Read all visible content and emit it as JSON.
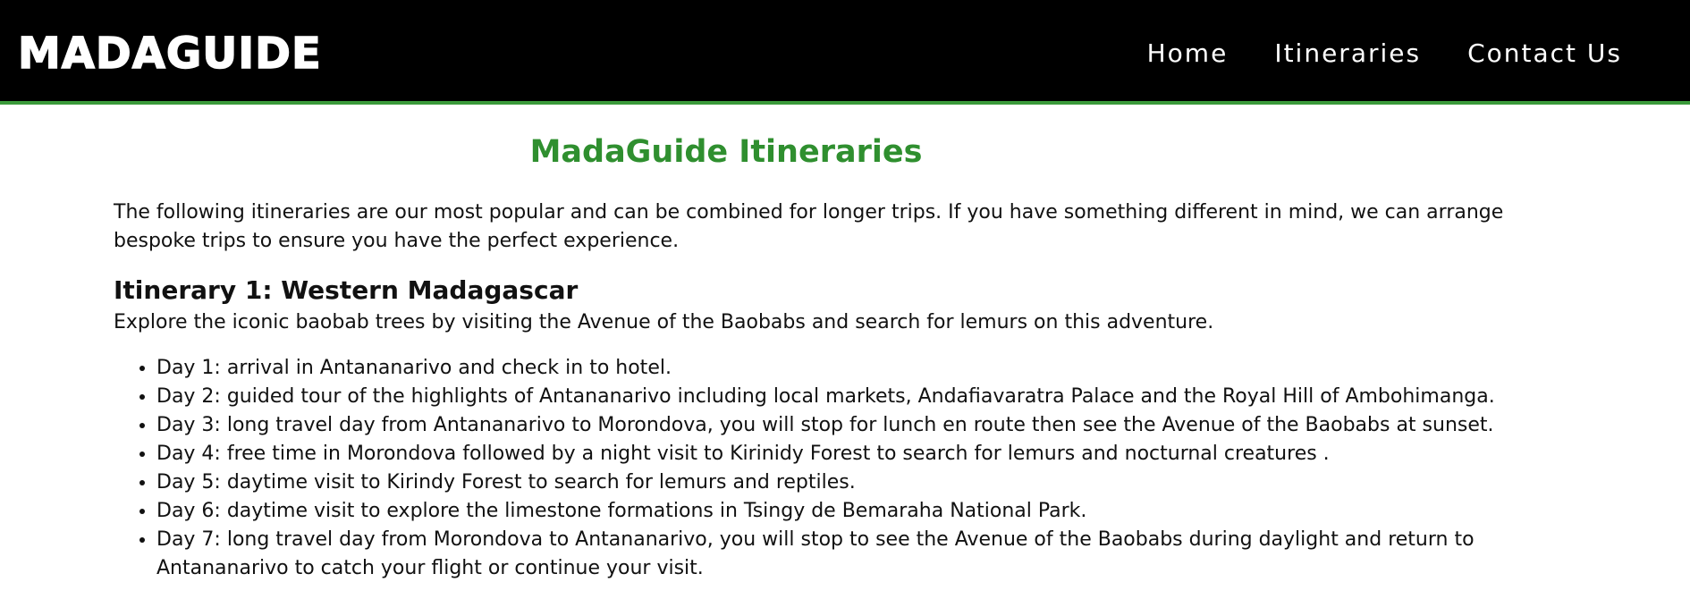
{
  "header": {
    "logo": "MADAGUIDE",
    "nav": [
      {
        "label": "Home"
      },
      {
        "label": "Itineraries"
      },
      {
        "label": "Contact Us"
      }
    ]
  },
  "main": {
    "title": "MadaGuide Itineraries",
    "intro": "The following itineraries are our most popular and can be combined for longer trips. If you have something different in mind, we can arrange bespoke trips to ensure you have the perfect experience.",
    "itinerary": {
      "heading": "Itinerary 1: Western Madagascar",
      "description": "Explore the iconic baobab trees by visiting the Avenue of the Baobabs and search for lemurs on this adventure.",
      "days": [
        "Day 1: arrival in Antananarivo and check in to hotel.",
        "Day 2: guided tour of the highlights of Antananarivo including local markets, Andafiavaratra Palace and the Royal Hill of Ambohimanga.",
        "Day 3: long travel day from Antananarivo to Morondova, you will stop for lunch en route then see the Avenue of the Baobabs at sunset.",
        "Day 4: free time in Morondova followed by a night visit to Kirinidy Forest to search for lemurs and nocturnal creatures .",
        "Day 5: daytime visit to Kirindy Forest to search for lemurs and reptiles.",
        "Day 6: daytime visit to explore the limestone formations in Tsingy de Bemaraha National Park.",
        "Day 7: long travel day from Morondova to Antananarivo, you will stop to see the Avenue of the Baobabs during daylight and return to Antananarivo to catch your flight or continue your visit."
      ]
    }
  },
  "colors": {
    "header_bg": "#000000",
    "header_border": "#3a9a3a",
    "title": "#2f8f2f",
    "text": "#111111"
  }
}
